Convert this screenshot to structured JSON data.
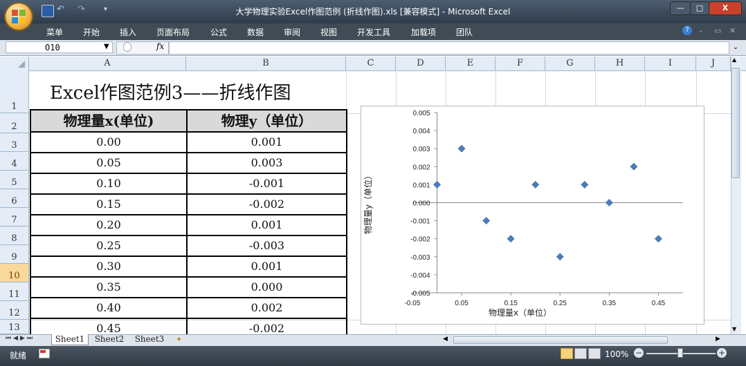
{
  "window": {
    "title": "大学物理实验Excel作图范例 (折线作图).xls  [兼容模式] - Microsoft Excel",
    "min_label": "—",
    "max_label": "□",
    "close_label": "X"
  },
  "ribbon": {
    "tabs": [
      "菜单",
      "开始",
      "插入",
      "页面布局",
      "公式",
      "数据",
      "审阅",
      "视图",
      "开发工具",
      "加载项",
      "团队"
    ]
  },
  "formula_bar": {
    "name_box": "O10",
    "fx_label": "fx",
    "formula": ""
  },
  "columns": [
    "A",
    "B",
    "C",
    "D",
    "E",
    "F",
    "G",
    "H",
    "I",
    "J"
  ],
  "rows": [
    "1",
    "2",
    "3",
    "4",
    "5",
    "6",
    "7",
    "8",
    "9",
    "10",
    "11",
    "12",
    "13"
  ],
  "sheet": {
    "title": "Excel作图范例3——折线作图",
    "header_x": "物理量x(单位)",
    "header_y": "物理y（单位）",
    "data": [
      [
        "0.00",
        "0.001"
      ],
      [
        "0.05",
        "0.003"
      ],
      [
        "0.10",
        "-0.001"
      ],
      [
        "0.15",
        "-0.002"
      ],
      [
        "0.20",
        "0.001"
      ],
      [
        "0.25",
        "-0.003"
      ],
      [
        "0.30",
        "0.001"
      ],
      [
        "0.35",
        "0.000"
      ],
      [
        "0.40",
        "0.002"
      ],
      [
        "0.45",
        "-0.002"
      ]
    ]
  },
  "chart_data": {
    "type": "scatter",
    "xlabel": "物理量x（单位）",
    "ylabel": "物理量y（单位）",
    "xlim": [
      -0.05,
      0.5
    ],
    "ylim": [
      -0.005,
      0.005
    ],
    "x_ticks": [
      "-0.05",
      "0.05",
      "0.15",
      "0.25",
      "0.35",
      "0.45"
    ],
    "y_ticks": [
      "0.005",
      "0.004",
      "0.003",
      "0.002",
      "0.001",
      "0.000",
      "-0.001",
      "-0.002",
      "-0.003",
      "-0.004",
      "-0.005"
    ],
    "x_tick_values": [
      -0.05,
      0.05,
      0.15,
      0.25,
      0.35,
      0.45
    ],
    "y_tick_values": [
      0.005,
      0.004,
      0.003,
      0.002,
      0.001,
      0.0,
      -0.001,
      -0.002,
      -0.003,
      -0.004,
      -0.005
    ],
    "series": [
      {
        "x": [
          0.0,
          0.05,
          0.1,
          0.15,
          0.2,
          0.25,
          0.3,
          0.35,
          0.4,
          0.45
        ],
        "y": [
          0.001,
          0.003,
          -0.001,
          -0.002,
          0.001,
          -0.003,
          0.001,
          0.0,
          0.002,
          -0.002
        ],
        "marker": "diamond",
        "color": "#4a7ebb"
      }
    ],
    "grid": false,
    "legend": "none"
  },
  "sheet_tabs": [
    "Sheet1",
    "Sheet2",
    "Sheet3"
  ],
  "status": {
    "ready": "就绪",
    "zoom": "100%"
  },
  "colors": {
    "titlebar": "#3b4a5a",
    "close": "#c8412a",
    "marker": "#4a7ebb",
    "header_fill": "#d9d9d9",
    "selected_row": "#f9d99b"
  }
}
